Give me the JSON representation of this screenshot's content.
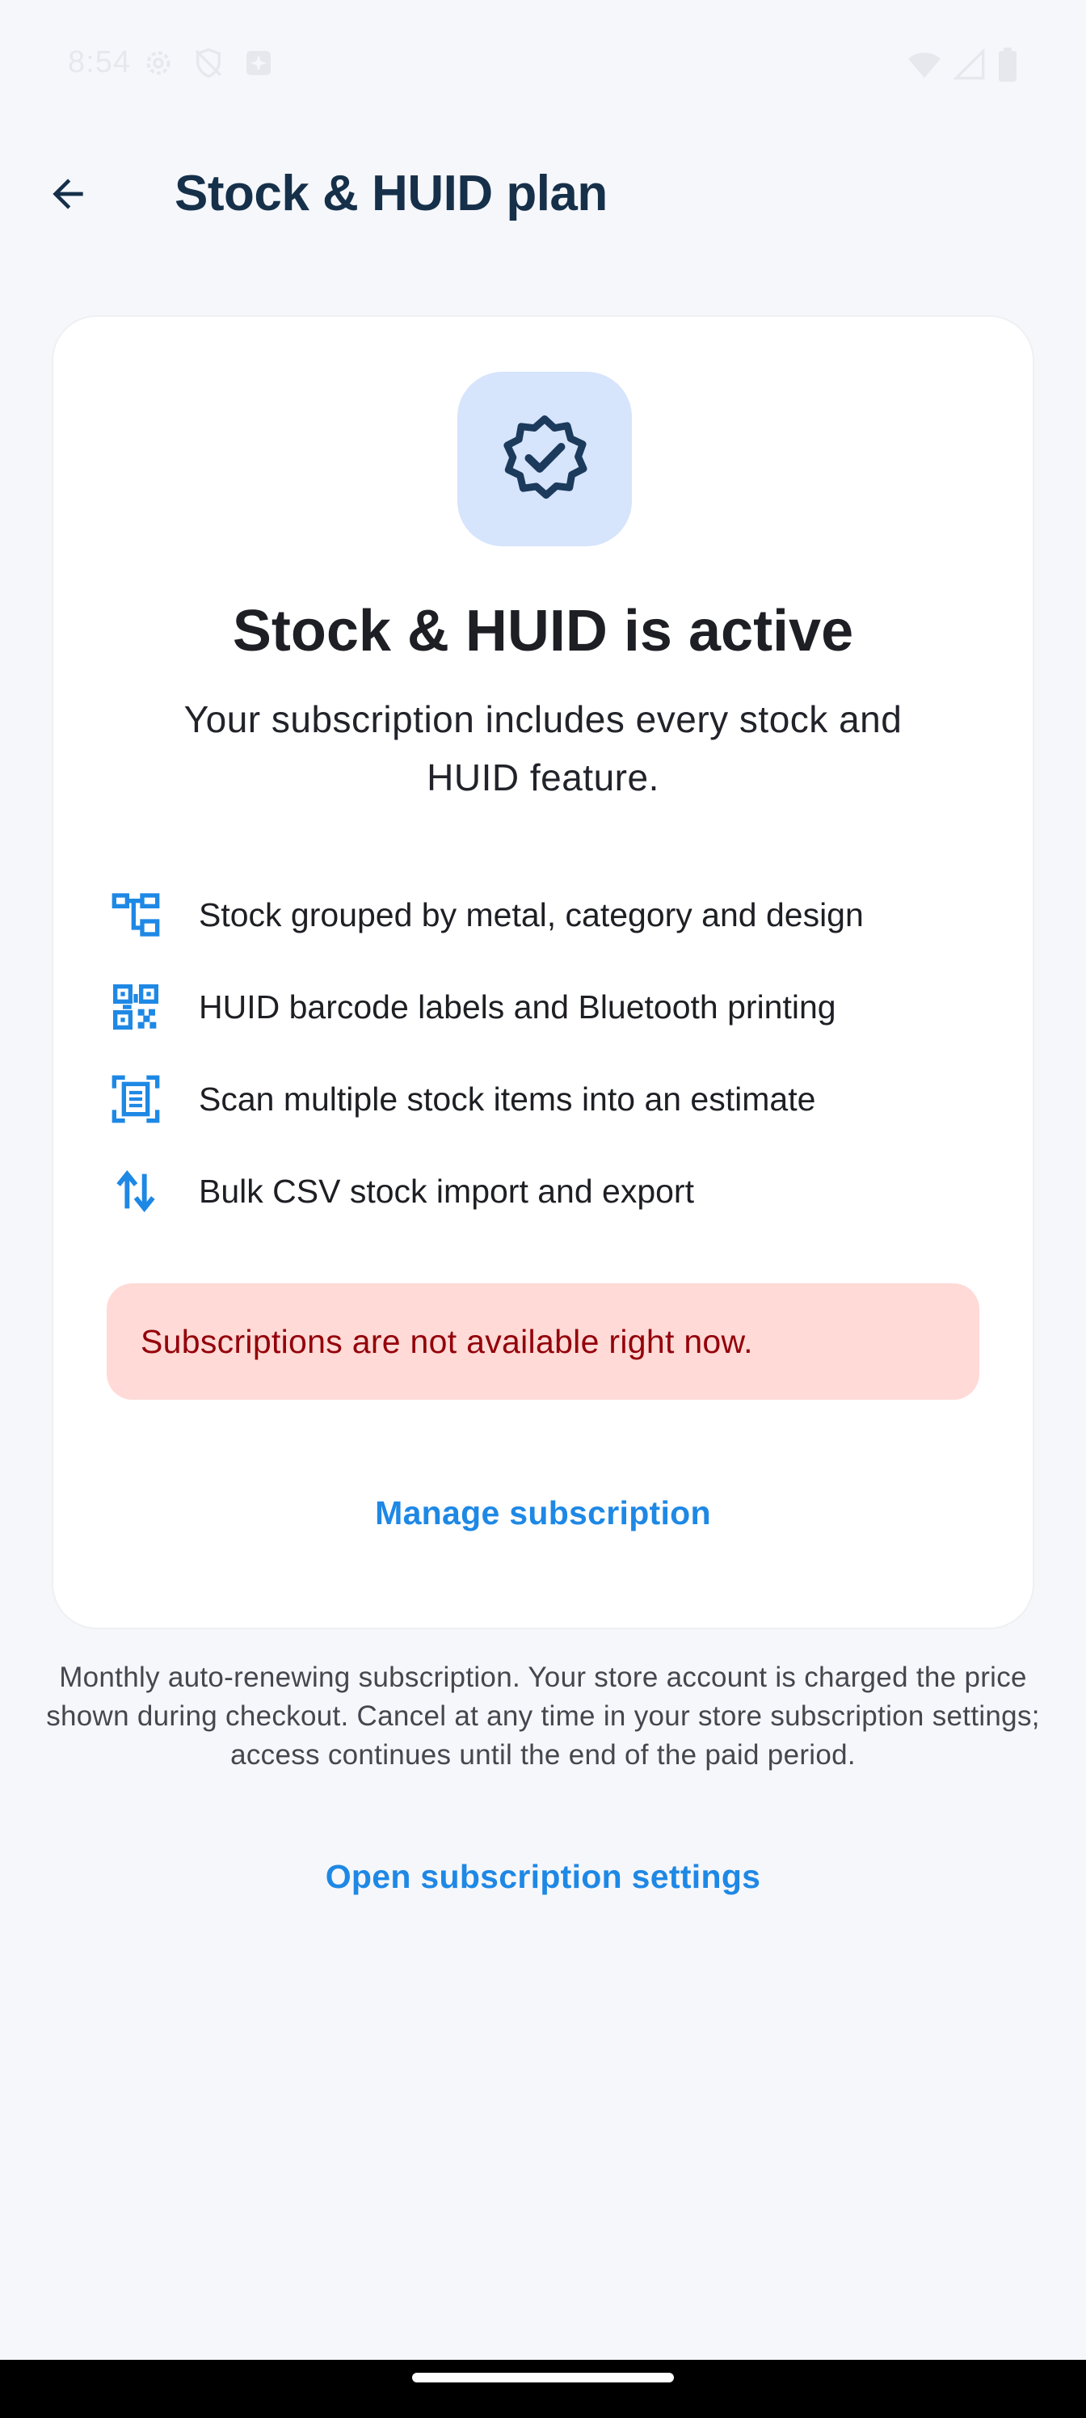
{
  "status_bar": {
    "time": "8:54",
    "left_icons": [
      "settings-gear-icon",
      "shield-off-icon",
      "sparkle-notification-icon"
    ],
    "right_icons": [
      "wifi-icon",
      "cell-signal-icon",
      "battery-icon"
    ]
  },
  "app_bar": {
    "back_icon": "arrow-back-icon",
    "title": "Stock & HUID plan"
  },
  "card": {
    "badge_icon": "verified-badge-icon",
    "title": "Stock & HUID is active",
    "subtitle": "Your subscription includes every stock and HUID feature.",
    "features": [
      {
        "icon": "account-tree-icon",
        "label": "Stock grouped by metal, category and design"
      },
      {
        "icon": "qr-code-icon",
        "label": "HUID barcode labels and Bluetooth printing"
      },
      {
        "icon": "document-scanner-icon",
        "label": "Scan multiple stock items into an estimate"
      },
      {
        "icon": "import-export-icon",
        "label": "Bulk CSV stock import and export"
      }
    ],
    "error_message": "Subscriptions are not available right now.",
    "manage_button": "Manage subscription"
  },
  "footnote": "Monthly auto-renewing subscription. Your store account is charged the price shown during checkout. Cancel at any time in your store subscription settings; access continues until the end of the paid period.",
  "open_settings_link": "Open subscription settings",
  "colors": {
    "background": "#F6F7FB",
    "card": "#FFFFFF",
    "title_dark": "#16304A",
    "accent_blue": "#1E88E5",
    "badge_tile": "#D6E4FC",
    "badge_icon": "#1B3A5C",
    "error_bg": "#FFDAD6",
    "error_text": "#93000A"
  }
}
